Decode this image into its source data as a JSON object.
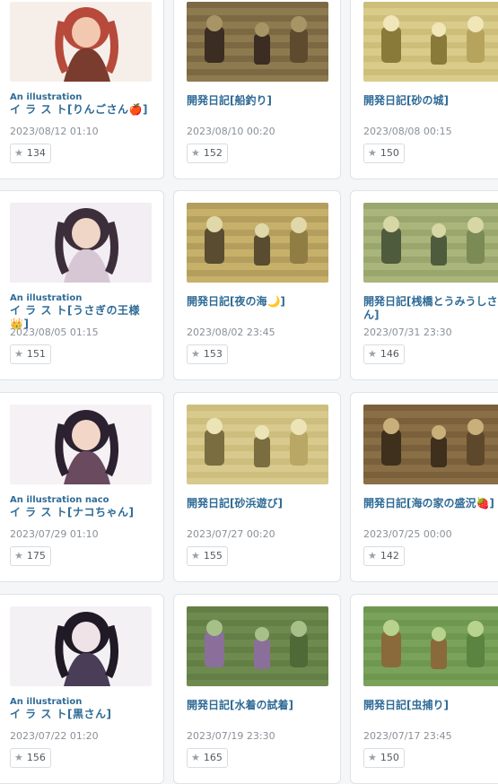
{
  "cards": [
    {
      "sub": "An illustration",
      "title": "イ ラ ス ト[りんごさん🍎]",
      "date": "2023/08/12 01:10",
      "likes": "134",
      "palette": [
        "#f6efe9",
        "#b74a3b",
        "#7a3c2e",
        "#f2c9b0"
      ]
    },
    {
      "sub": "",
      "title": "開発日記[船釣り]",
      "date": "2023/08/10 00:20",
      "likes": "152",
      "palette": [
        "#8d7a4f",
        "#5e4a2f",
        "#a89566",
        "#3b2d22"
      ]
    },
    {
      "sub": "",
      "title": "開発日記[砂の城]",
      "date": "2023/08/08 00:15",
      "likes": "150",
      "palette": [
        "#d9cc8a",
        "#b7a45c",
        "#f0e6b8",
        "#8a7a3a"
      ]
    },
    {
      "sub": "An illustration",
      "title": "イ ラ ス ト[うさぎの王様👑]",
      "date": "2023/08/05 01:15",
      "likes": "151",
      "palette": [
        "#f3eef3",
        "#3c2f3b",
        "#d7c7d4",
        "#f0d6c6"
      ]
    },
    {
      "sub": "",
      "title": "開発日記[夜の海🌙]",
      "date": "2023/08/02 23:45",
      "likes": "153",
      "palette": [
        "#c6b06a",
        "#8f7d44",
        "#e0d8a9",
        "#5a4c30"
      ]
    },
    {
      "sub": "",
      "title": "開発日記[桟橋とうみうしさん]",
      "date": "2023/07/31 23:30",
      "likes": "146",
      "palette": [
        "#a9b57a",
        "#7c8a55",
        "#d7d6a5",
        "#4f5b3d"
      ]
    },
    {
      "sub": "An illustration naco",
      "title": "イ ラ ス ト[ナコちゃん]",
      "date": "2023/07/29 01:10",
      "likes": "175",
      "palette": [
        "#f5f1f4",
        "#2b2130",
        "#6a4a5e",
        "#f2d7c9"
      ]
    },
    {
      "sub": "",
      "title": "開発日記[砂浜遊び]",
      "date": "2023/07/27 00:20",
      "likes": "155",
      "palette": [
        "#d8c98c",
        "#b9a865",
        "#ece3b7",
        "#7a6d3f"
      ]
    },
    {
      "sub": "",
      "title": "開発日記[海の家の盛況🍓]",
      "date": "2023/07/25 00:00",
      "likes": "142",
      "palette": [
        "#8a6e45",
        "#5e482b",
        "#c9b07a",
        "#3f2f1d"
      ]
    },
    {
      "sub": "An illustration",
      "title": "イ ラ ス ト[黒さん]",
      "date": "2023/07/22 01:20",
      "likes": "156",
      "palette": [
        "#f4f1f5",
        "#1f1a25",
        "#4a3d57",
        "#f0e3e8"
      ]
    },
    {
      "sub": "",
      "title": "開発日記[水着の試着]",
      "date": "2023/07/19 23:30",
      "likes": "165",
      "palette": [
        "#6f8a4e",
        "#4f6a36",
        "#a7c08a",
        "#8b6f9b"
      ]
    },
    {
      "sub": "",
      "title": "開発日記[虫捕り]",
      "date": "2023/07/17 23:45",
      "likes": "150",
      "palette": [
        "#7aa25a",
        "#5a8440",
        "#b7d38d",
        "#8a6a3a"
      ]
    }
  ],
  "icons": {
    "star": "star-icon"
  },
  "colors": {
    "title": "#2f6b96",
    "date": "#8a9098"
  }
}
